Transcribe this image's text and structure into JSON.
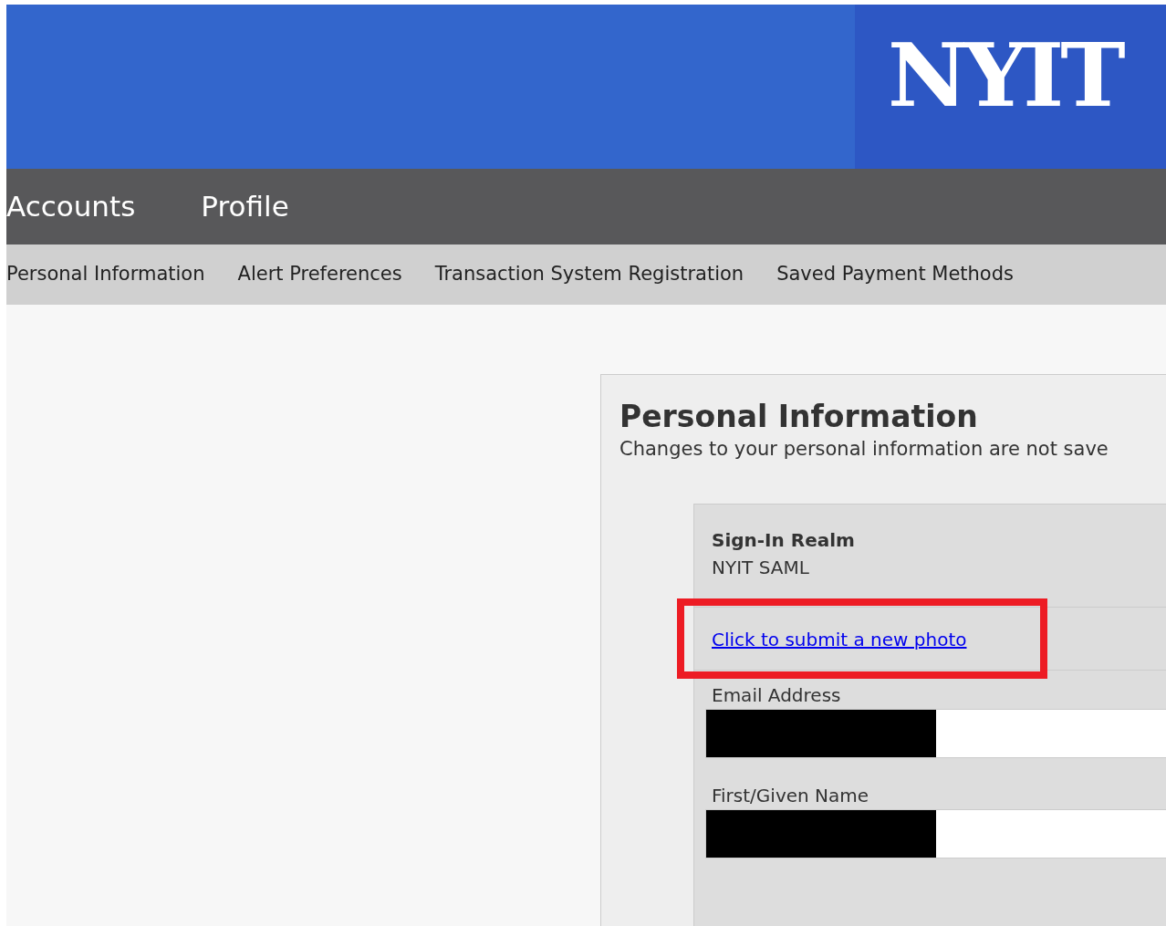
{
  "header": {
    "logo": "NYIT"
  },
  "main_nav": [
    {
      "label": "Accounts"
    },
    {
      "label": "Profile"
    }
  ],
  "sub_nav": [
    {
      "label": "Personal Information"
    },
    {
      "label": "Alert Preferences"
    },
    {
      "label": "Transaction System Registration"
    },
    {
      "label": "Saved Payment Methods"
    }
  ],
  "panel": {
    "title": "Personal Information",
    "subtitle": "Changes to your personal information are not save",
    "sign_in_realm": {
      "label": "Sign-In Realm",
      "value": "NYIT SAML"
    },
    "photo_link": "Click to submit a new photo",
    "fields": [
      {
        "label": "Email Address",
        "redacted": true
      },
      {
        "label": "First/Given Name",
        "redacted": true
      }
    ]
  }
}
